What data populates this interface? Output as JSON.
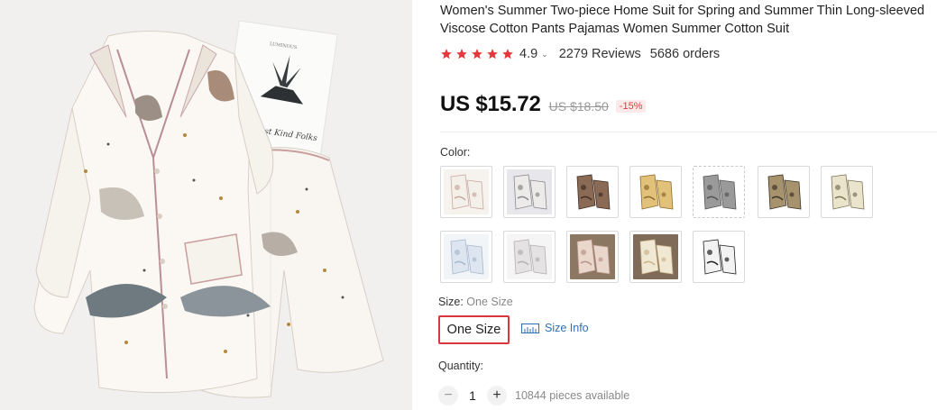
{
  "product": {
    "title": "Women's Summer Two-piece Home Suit for Spring and Summer Thin Long-sleeved Viscose Cotton Pants Pajamas Women Summer Cotton Suit",
    "rating": "4.9",
    "rating_value": 4.9,
    "rating_max": 5,
    "reviews": "2279 Reviews",
    "orders": "5686 orders"
  },
  "price": {
    "current": "US $15.72",
    "original": "US $18.50",
    "discount": "-15%"
  },
  "color": {
    "label": "Color:",
    "swatches": [
      {
        "name": "white-floral",
        "bg": "#f6f2ee",
        "fabric": "#f3efe9",
        "accent": "#c9a8a0"
      },
      {
        "name": "white-print",
        "bg": "#e7e6ea",
        "fabric": "#ecebea",
        "accent": "#8a8a8e"
      },
      {
        "name": "brown-print",
        "bg": "#ffffff",
        "fabric": "#8b6a55",
        "accent": "#3f2e24"
      },
      {
        "name": "gold-print",
        "bg": "#ffffff",
        "fabric": "#e2c27a",
        "accent": "#8d6a2d"
      },
      {
        "name": "grey-print",
        "bg": "#ffffff",
        "fabric": "#9a9a9a",
        "accent": "#555555"
      },
      {
        "name": "khaki-print",
        "bg": "#ffffff",
        "fabric": "#a7926e",
        "accent": "#3e3526"
      },
      {
        "name": "cream-print",
        "bg": "#ffffff",
        "fabric": "#eae4cc",
        "accent": "#7c7456"
      },
      {
        "name": "light-blue",
        "bg": "#f2f5f8",
        "fabric": "#dde6f0",
        "accent": "#a8b8cc"
      },
      {
        "name": "light-grey",
        "bg": "#f5f5f5",
        "fabric": "#e4e2e2",
        "accent": "#b5b1b1"
      },
      {
        "name": "pink-on-brown",
        "bg": "#8b7762",
        "fabric": "#e9d7cc",
        "accent": "#b8938a"
      },
      {
        "name": "cream-on-brown",
        "bg": "#7f6b57",
        "fabric": "#f1e8d3",
        "accent": "#c9b48c"
      },
      {
        "name": "black-white",
        "bg": "#ffffff",
        "fabric": "#f2f2f2",
        "accent": "#1f1f1f"
      }
    ]
  },
  "size": {
    "label": "Size:",
    "selected": "One Size",
    "option": "One Size",
    "info_link": "Size Info"
  },
  "quantity": {
    "label": "Quantity:",
    "value": "1",
    "minus": "−",
    "plus": "+",
    "available": "10844 pieces available"
  },
  "colors": {
    "star": "#e4393c",
    "selected_border": "#d9363e",
    "link": "#2e6fb3"
  },
  "icons": {
    "rating_dropdown": "chevron-down-icon",
    "size_info": "ruler-icon"
  }
}
